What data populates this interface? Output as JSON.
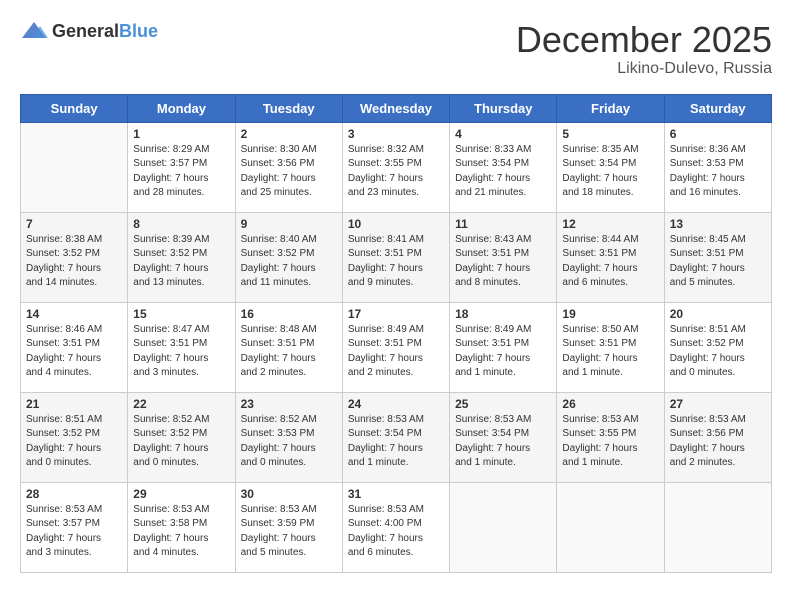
{
  "logo": {
    "general": "General",
    "blue": "Blue"
  },
  "header": {
    "month": "December 2025",
    "location": "Likino-Dulevo, Russia"
  },
  "weekdays": [
    "Sunday",
    "Monday",
    "Tuesday",
    "Wednesday",
    "Thursday",
    "Friday",
    "Saturday"
  ],
  "weeks": [
    [
      {
        "day": "",
        "content": ""
      },
      {
        "day": "1",
        "content": "Sunrise: 8:29 AM\nSunset: 3:57 PM\nDaylight: 7 hours\nand 28 minutes."
      },
      {
        "day": "2",
        "content": "Sunrise: 8:30 AM\nSunset: 3:56 PM\nDaylight: 7 hours\nand 25 minutes."
      },
      {
        "day": "3",
        "content": "Sunrise: 8:32 AM\nSunset: 3:55 PM\nDaylight: 7 hours\nand 23 minutes."
      },
      {
        "day": "4",
        "content": "Sunrise: 8:33 AM\nSunset: 3:54 PM\nDaylight: 7 hours\nand 21 minutes."
      },
      {
        "day": "5",
        "content": "Sunrise: 8:35 AM\nSunset: 3:54 PM\nDaylight: 7 hours\nand 18 minutes."
      },
      {
        "day": "6",
        "content": "Sunrise: 8:36 AM\nSunset: 3:53 PM\nDaylight: 7 hours\nand 16 minutes."
      }
    ],
    [
      {
        "day": "7",
        "content": "Sunrise: 8:38 AM\nSunset: 3:52 PM\nDaylight: 7 hours\nand 14 minutes."
      },
      {
        "day": "8",
        "content": "Sunrise: 8:39 AM\nSunset: 3:52 PM\nDaylight: 7 hours\nand 13 minutes."
      },
      {
        "day": "9",
        "content": "Sunrise: 8:40 AM\nSunset: 3:52 PM\nDaylight: 7 hours\nand 11 minutes."
      },
      {
        "day": "10",
        "content": "Sunrise: 8:41 AM\nSunset: 3:51 PM\nDaylight: 7 hours\nand 9 minutes."
      },
      {
        "day": "11",
        "content": "Sunrise: 8:43 AM\nSunset: 3:51 PM\nDaylight: 7 hours\nand 8 minutes."
      },
      {
        "day": "12",
        "content": "Sunrise: 8:44 AM\nSunset: 3:51 PM\nDaylight: 7 hours\nand 6 minutes."
      },
      {
        "day": "13",
        "content": "Sunrise: 8:45 AM\nSunset: 3:51 PM\nDaylight: 7 hours\nand 5 minutes."
      }
    ],
    [
      {
        "day": "14",
        "content": "Sunrise: 8:46 AM\nSunset: 3:51 PM\nDaylight: 7 hours\nand 4 minutes."
      },
      {
        "day": "15",
        "content": "Sunrise: 8:47 AM\nSunset: 3:51 PM\nDaylight: 7 hours\nand 3 minutes."
      },
      {
        "day": "16",
        "content": "Sunrise: 8:48 AM\nSunset: 3:51 PM\nDaylight: 7 hours\nand 2 minutes."
      },
      {
        "day": "17",
        "content": "Sunrise: 8:49 AM\nSunset: 3:51 PM\nDaylight: 7 hours\nand 2 minutes."
      },
      {
        "day": "18",
        "content": "Sunrise: 8:49 AM\nSunset: 3:51 PM\nDaylight: 7 hours\nand 1 minute."
      },
      {
        "day": "19",
        "content": "Sunrise: 8:50 AM\nSunset: 3:51 PM\nDaylight: 7 hours\nand 1 minute."
      },
      {
        "day": "20",
        "content": "Sunrise: 8:51 AM\nSunset: 3:52 PM\nDaylight: 7 hours\nand 0 minutes."
      }
    ],
    [
      {
        "day": "21",
        "content": "Sunrise: 8:51 AM\nSunset: 3:52 PM\nDaylight: 7 hours\nand 0 minutes."
      },
      {
        "day": "22",
        "content": "Sunrise: 8:52 AM\nSunset: 3:52 PM\nDaylight: 7 hours\nand 0 minutes."
      },
      {
        "day": "23",
        "content": "Sunrise: 8:52 AM\nSunset: 3:53 PM\nDaylight: 7 hours\nand 0 minutes."
      },
      {
        "day": "24",
        "content": "Sunrise: 8:53 AM\nSunset: 3:54 PM\nDaylight: 7 hours\nand 1 minute."
      },
      {
        "day": "25",
        "content": "Sunrise: 8:53 AM\nSunset: 3:54 PM\nDaylight: 7 hours\nand 1 minute."
      },
      {
        "day": "26",
        "content": "Sunrise: 8:53 AM\nSunset: 3:55 PM\nDaylight: 7 hours\nand 1 minute."
      },
      {
        "day": "27",
        "content": "Sunrise: 8:53 AM\nSunset: 3:56 PM\nDaylight: 7 hours\nand 2 minutes."
      }
    ],
    [
      {
        "day": "28",
        "content": "Sunrise: 8:53 AM\nSunset: 3:57 PM\nDaylight: 7 hours\nand 3 minutes."
      },
      {
        "day": "29",
        "content": "Sunrise: 8:53 AM\nSunset: 3:58 PM\nDaylight: 7 hours\nand 4 minutes."
      },
      {
        "day": "30",
        "content": "Sunrise: 8:53 AM\nSunset: 3:59 PM\nDaylight: 7 hours\nand 5 minutes."
      },
      {
        "day": "31",
        "content": "Sunrise: 8:53 AM\nSunset: 4:00 PM\nDaylight: 7 hours\nand 6 minutes."
      },
      {
        "day": "",
        "content": ""
      },
      {
        "day": "",
        "content": ""
      },
      {
        "day": "",
        "content": ""
      }
    ]
  ]
}
